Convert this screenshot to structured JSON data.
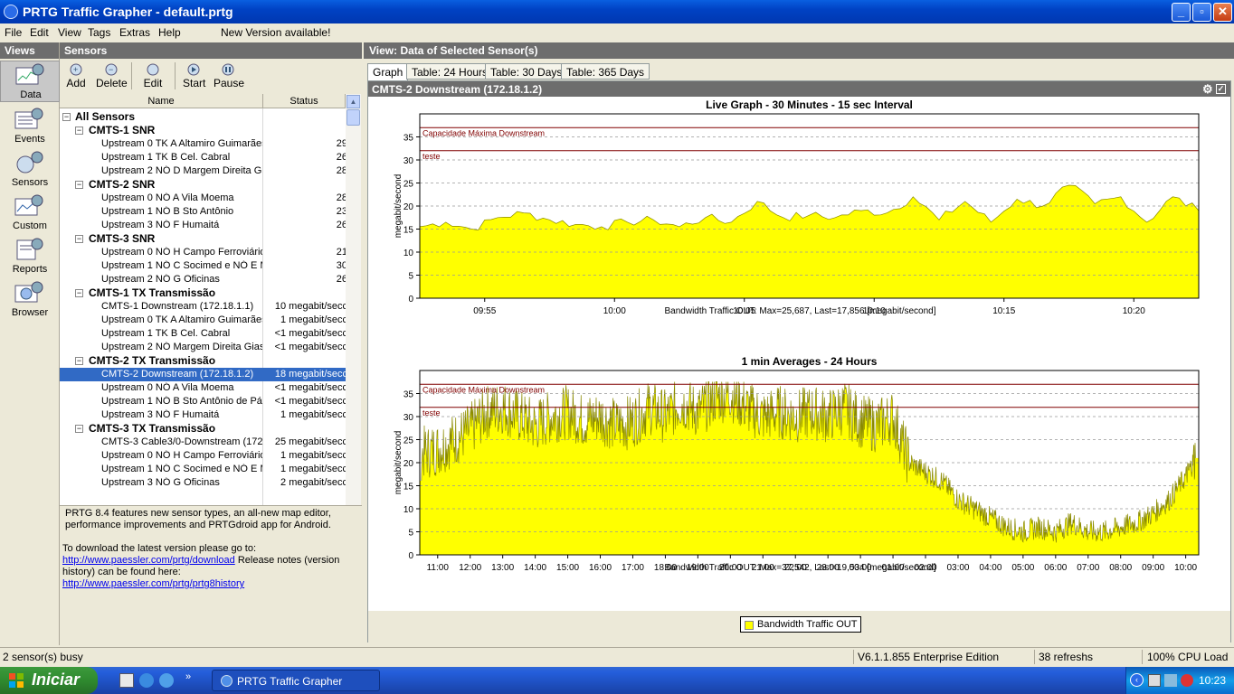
{
  "window": {
    "title": "PRTG Traffic Grapher - default.prtg"
  },
  "menu": {
    "items": [
      "File",
      "Edit",
      "View",
      "Tags",
      "Extras",
      "Help"
    ],
    "notice": "New Version available!"
  },
  "views": {
    "header": "Views",
    "items": [
      "Data",
      "Events",
      "Sensors",
      "Custom",
      "Reports",
      "Browser"
    ]
  },
  "sensors": {
    "header": "Sensors",
    "toolbar": [
      "Add",
      "Delete",
      "Edit",
      "Start",
      "Pause"
    ],
    "columns": {
      "name": "Name",
      "status": "Status"
    },
    "root": "All Sensors",
    "rows": [
      {
        "type": "group",
        "name": "CMTS-1 SNR"
      },
      {
        "type": "item",
        "name": "Upstream 0 TK A Altamiro Guimarães",
        "status": "29"
      },
      {
        "type": "item",
        "name": "Upstream 1 TK B Cel. Cabral",
        "status": "26"
      },
      {
        "type": "item",
        "name": "Upstream 2 NÓ D Margem Direita Giassi",
        "status": "28"
      },
      {
        "type": "group",
        "name": "CMTS-2 SNR"
      },
      {
        "type": "item",
        "name": "Upstream 0 NÓ A Vila Moema",
        "status": "28"
      },
      {
        "type": "item",
        "name": "Upstream 1 NÓ B Sto Antônio",
        "status": "23"
      },
      {
        "type": "item",
        "name": "Upstream 3 NÓ F Humaitá",
        "status": "26"
      },
      {
        "type": "group",
        "name": "CMTS-3 SNR"
      },
      {
        "type": "item",
        "name": "Upstream 0 NÓ H Campo Ferroviário",
        "status": "21"
      },
      {
        "type": "item",
        "name": "Upstream 1 NÓ C Socimed e NÓ E M",
        "status": "30"
      },
      {
        "type": "item",
        "name": "Upstream 2 NÓ G Oficinas",
        "status": "26"
      },
      {
        "type": "group",
        "name": "CMTS-1 TX Transmissão"
      },
      {
        "type": "item",
        "name": "CMTS-1 Downstream (172.18.1.1)",
        "status": "10 megabit/secc"
      },
      {
        "type": "item",
        "name": "Upstream 0 TK A Altamiro Guimarães",
        "status": "1 megabit/secc"
      },
      {
        "type": "item",
        "name": "Upstream 1 TK B Cel. Cabral",
        "status": "<1 megabit/secc"
      },
      {
        "type": "item",
        "name": "Upstream 2 NÓ Margem Direita Giassi",
        "status": "<1 megabit/secc"
      },
      {
        "type": "group",
        "name": "CMTS-2 TX Transmissão"
      },
      {
        "type": "item",
        "name": "CMTS-2 Downstream (172.18.1.2)",
        "status": "18 megabit/secc",
        "selected": true
      },
      {
        "type": "item",
        "name": "Upstream 0 NÓ A Vila Moema",
        "status": "<1 megabit/secc"
      },
      {
        "type": "item",
        "name": "Upstream 1 NÓ B Sto Antônio de Pádua",
        "status": "<1 megabit/secc"
      },
      {
        "type": "item",
        "name": "Upstream 3 NÓ F Humaitá",
        "status": "1 megabit/secc"
      },
      {
        "type": "group",
        "name": "CMTS-3 TX Transmissão"
      },
      {
        "type": "item",
        "name": "CMTS-3 Cable3/0-Downstream (172.18.1.3)",
        "status": "25 megabit/secc"
      },
      {
        "type": "item",
        "name": "Upstream 0 NÓ H Campo Ferroviário",
        "status": "1 megabit/secc"
      },
      {
        "type": "item",
        "name": "Upstream 1 NÓ C Socimed e NÓ E M",
        "status": "1 megabit/secc"
      },
      {
        "type": "item",
        "name": "Upstream 3 NÓ G Oficinas",
        "status": "2 megabit/secc"
      }
    ]
  },
  "info": {
    "text1": "PRTG 8.4 features new sensor types, an all-new map editor, performance improvements and PRTGdroid app for Android.",
    "text2": "To download the latest version please go to:",
    "link1": "http://www.paessler.com/prtg/download",
    "text3": "  Release notes (version history) can be found here:",
    "link2": "http://www.paessler.com/prtg/prtg8history"
  },
  "view": {
    "header": "View: Data of Selected Sensor(s)",
    "tabs": [
      "Graph",
      "Table: 24 Hours",
      "Table: 30 Days",
      "Table: 365 Days"
    ],
    "panel_title": "CMTS-2 Downstream (172.18.1.2)",
    "legend": "Bandwidth Traffic OUT"
  },
  "chart_data": [
    {
      "type": "area",
      "title": "Live Graph - 30 Minutes - 15 sec Interval",
      "ylabel": "megabit/second",
      "xlabel": "Bandwidth Traffic OUT: Max=25,687, Last=17,856 [megabit/second]",
      "ylim": [
        0,
        40
      ],
      "yticks": [
        0,
        5,
        10,
        15,
        20,
        25,
        30,
        35
      ],
      "xticks": [
        "09:55",
        "10:00",
        "10:05",
        "10:10",
        "10:15",
        "10:20"
      ],
      "xtick_minutes": [
        2.5,
        7.5,
        12.5,
        17.5,
        22.5,
        27.5
      ],
      "x_range_minutes": [
        0,
        30
      ],
      "color": "#ffff00",
      "thresholds": [
        {
          "label": "Capacidade Máxima Downstream",
          "value": 37
        },
        {
          "label": "teste",
          "value": 32
        }
      ],
      "x": [
        0,
        1,
        2,
        3,
        4,
        5,
        6,
        7,
        8,
        9,
        10,
        11,
        12,
        13,
        14,
        15,
        16,
        17,
        18,
        19,
        20,
        21,
        22,
        23,
        24,
        25,
        26,
        27,
        28,
        29,
        30
      ],
      "values": [
        15.5,
        16.5,
        15,
        17.5,
        18.5,
        17,
        16,
        15.5,
        16.5,
        17,
        15.5,
        17.5,
        16.5,
        21,
        17.5,
        18,
        17.5,
        19,
        18.5,
        22,
        17,
        21,
        16.5,
        21.5,
        20,
        24.5,
        20.5,
        22,
        16.5,
        22,
        19
      ],
      "max": 25.687,
      "last": 17.856
    },
    {
      "type": "area",
      "title": "1 min Averages - 24 Hours",
      "ylabel": "megabit/second",
      "xlabel": "Bandwidth Traffic OUT: Max=37,542, Last=19,534 [megabit/second]",
      "ylim": [
        0,
        40
      ],
      "yticks": [
        0,
        5,
        10,
        15,
        20,
        25,
        30,
        35
      ],
      "xticks": [
        "11:00",
        "12:00",
        "13:00",
        "14:00",
        "15:00",
        "16:00",
        "17:00",
        "18:00",
        "19:00",
        "20:00",
        "21:00",
        "22:00",
        "23:00",
        "00:00",
        "01:00",
        "02:00",
        "03:00",
        "04:00",
        "05:00",
        "06:00",
        "07:00",
        "08:00",
        "09:00",
        "10:00"
      ],
      "x_range_hours": [
        10.45,
        34.4
      ],
      "color": "#ffff00",
      "thresholds": [
        {
          "label": "Capacidade Máxima Downstream",
          "value": 37
        },
        {
          "label": "teste",
          "value": 32
        }
      ],
      "x_hours": [
        10.5,
        11,
        11.5,
        12,
        12.5,
        13,
        13.5,
        14,
        14.5,
        15,
        15.5,
        16,
        16.5,
        17,
        17.5,
        18,
        18.5,
        19,
        19.5,
        20,
        20.5,
        21,
        21.5,
        22,
        22.5,
        23,
        23.5,
        24,
        24.5,
        25,
        25.5,
        26,
        26.5,
        27,
        27.5,
        28,
        28.5,
        29,
        29.5,
        30,
        30.5,
        31,
        31.5,
        32,
        32.5,
        33,
        33.5,
        34,
        34.3
      ],
      "values": [
        22,
        23,
        25,
        27,
        31,
        32,
        30,
        28,
        30,
        31,
        29,
        30,
        28,
        29,
        32,
        30,
        33,
        31,
        34,
        35,
        32,
        30,
        31,
        30,
        31,
        30,
        32,
        29,
        28,
        30,
        20,
        18,
        16,
        12,
        10,
        8,
        6,
        5,
        6,
        5,
        7,
        5,
        5,
        6,
        7,
        9,
        12,
        17,
        21
      ],
      "max": 37.542,
      "last": 19.534
    }
  ],
  "statusbar": {
    "left": "2 sensor(s) busy",
    "version": "V6.1.1.855 Enterprise Edition",
    "refreshs": "38 refreshs",
    "cpu": "100% CPU Load"
  },
  "taskbar": {
    "start": "Iniciar",
    "task": "PRTG Traffic Grapher",
    "clock": "10:23"
  }
}
